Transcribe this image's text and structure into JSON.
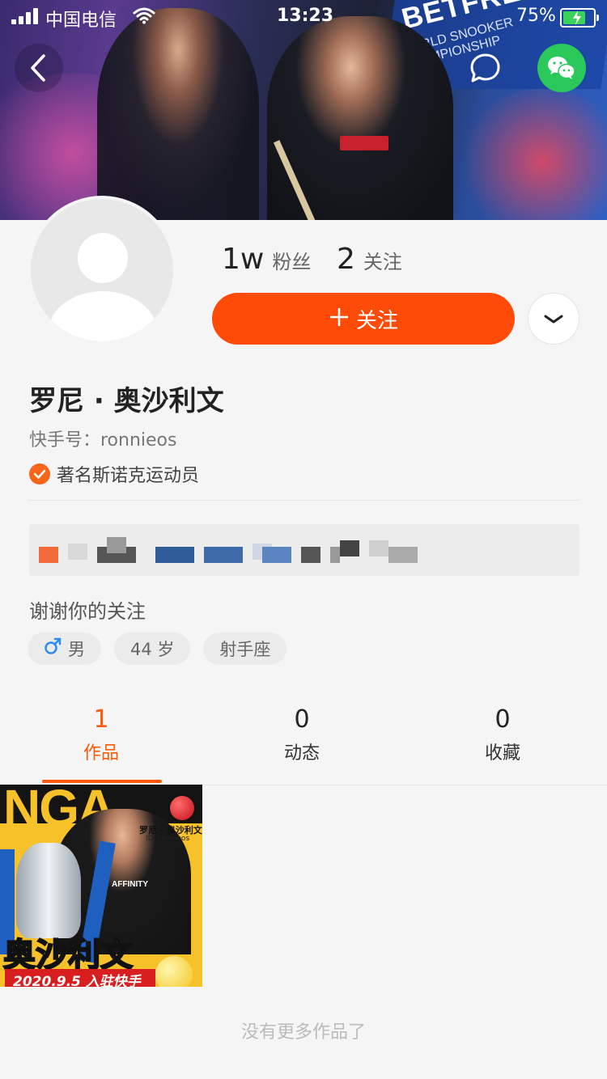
{
  "status_bar": {
    "carrier": "中国电信",
    "time": "13:23",
    "battery_percent": "75%",
    "battery_level": 0.75
  },
  "header": {
    "back_icon": "chevron-left-icon",
    "chat_icon": "chat-bubble-icon",
    "wechat_icon": "wechat-icon"
  },
  "banner": {
    "sign_text": "BETFRED",
    "sign_subtext": "WORLD SNOOKER CHAMPIONSHIP"
  },
  "profile": {
    "fans_count": "1w",
    "fans_label": "粉丝",
    "following_count": "2",
    "following_label": "关注",
    "follow_button_label": "关注",
    "name": "罗尼 · 奥沙利文",
    "user_id": "快手号：ronnieos",
    "verification": "著名斯诺克运动员",
    "bio": "谢谢你的关注",
    "tags": {
      "gender": "男",
      "age": "44 岁",
      "zodiac": "射手座"
    }
  },
  "tabs": [
    {
      "count": "1",
      "label": "作品"
    },
    {
      "count": "0",
      "label": "动态"
    },
    {
      "count": "0",
      "label": "收藏"
    }
  ],
  "works": [
    {
      "headline": "NGA",
      "person_name": "罗尼 · 奥沙利文",
      "person_id": "ID: ronnieos",
      "sponsor": "AFFINITY",
      "big_name": "奥沙利文",
      "date_text": "2020.9.5 入驻快手"
    }
  ],
  "footer": {
    "no_more_text": "没有更多作品了"
  },
  "colors": {
    "accent": "#fe4b07",
    "tab_active": "#fe5a0b",
    "wechat_green": "#2bc85a",
    "verify_orange": "#f7651a",
    "male_blue": "#2b8cf0"
  }
}
